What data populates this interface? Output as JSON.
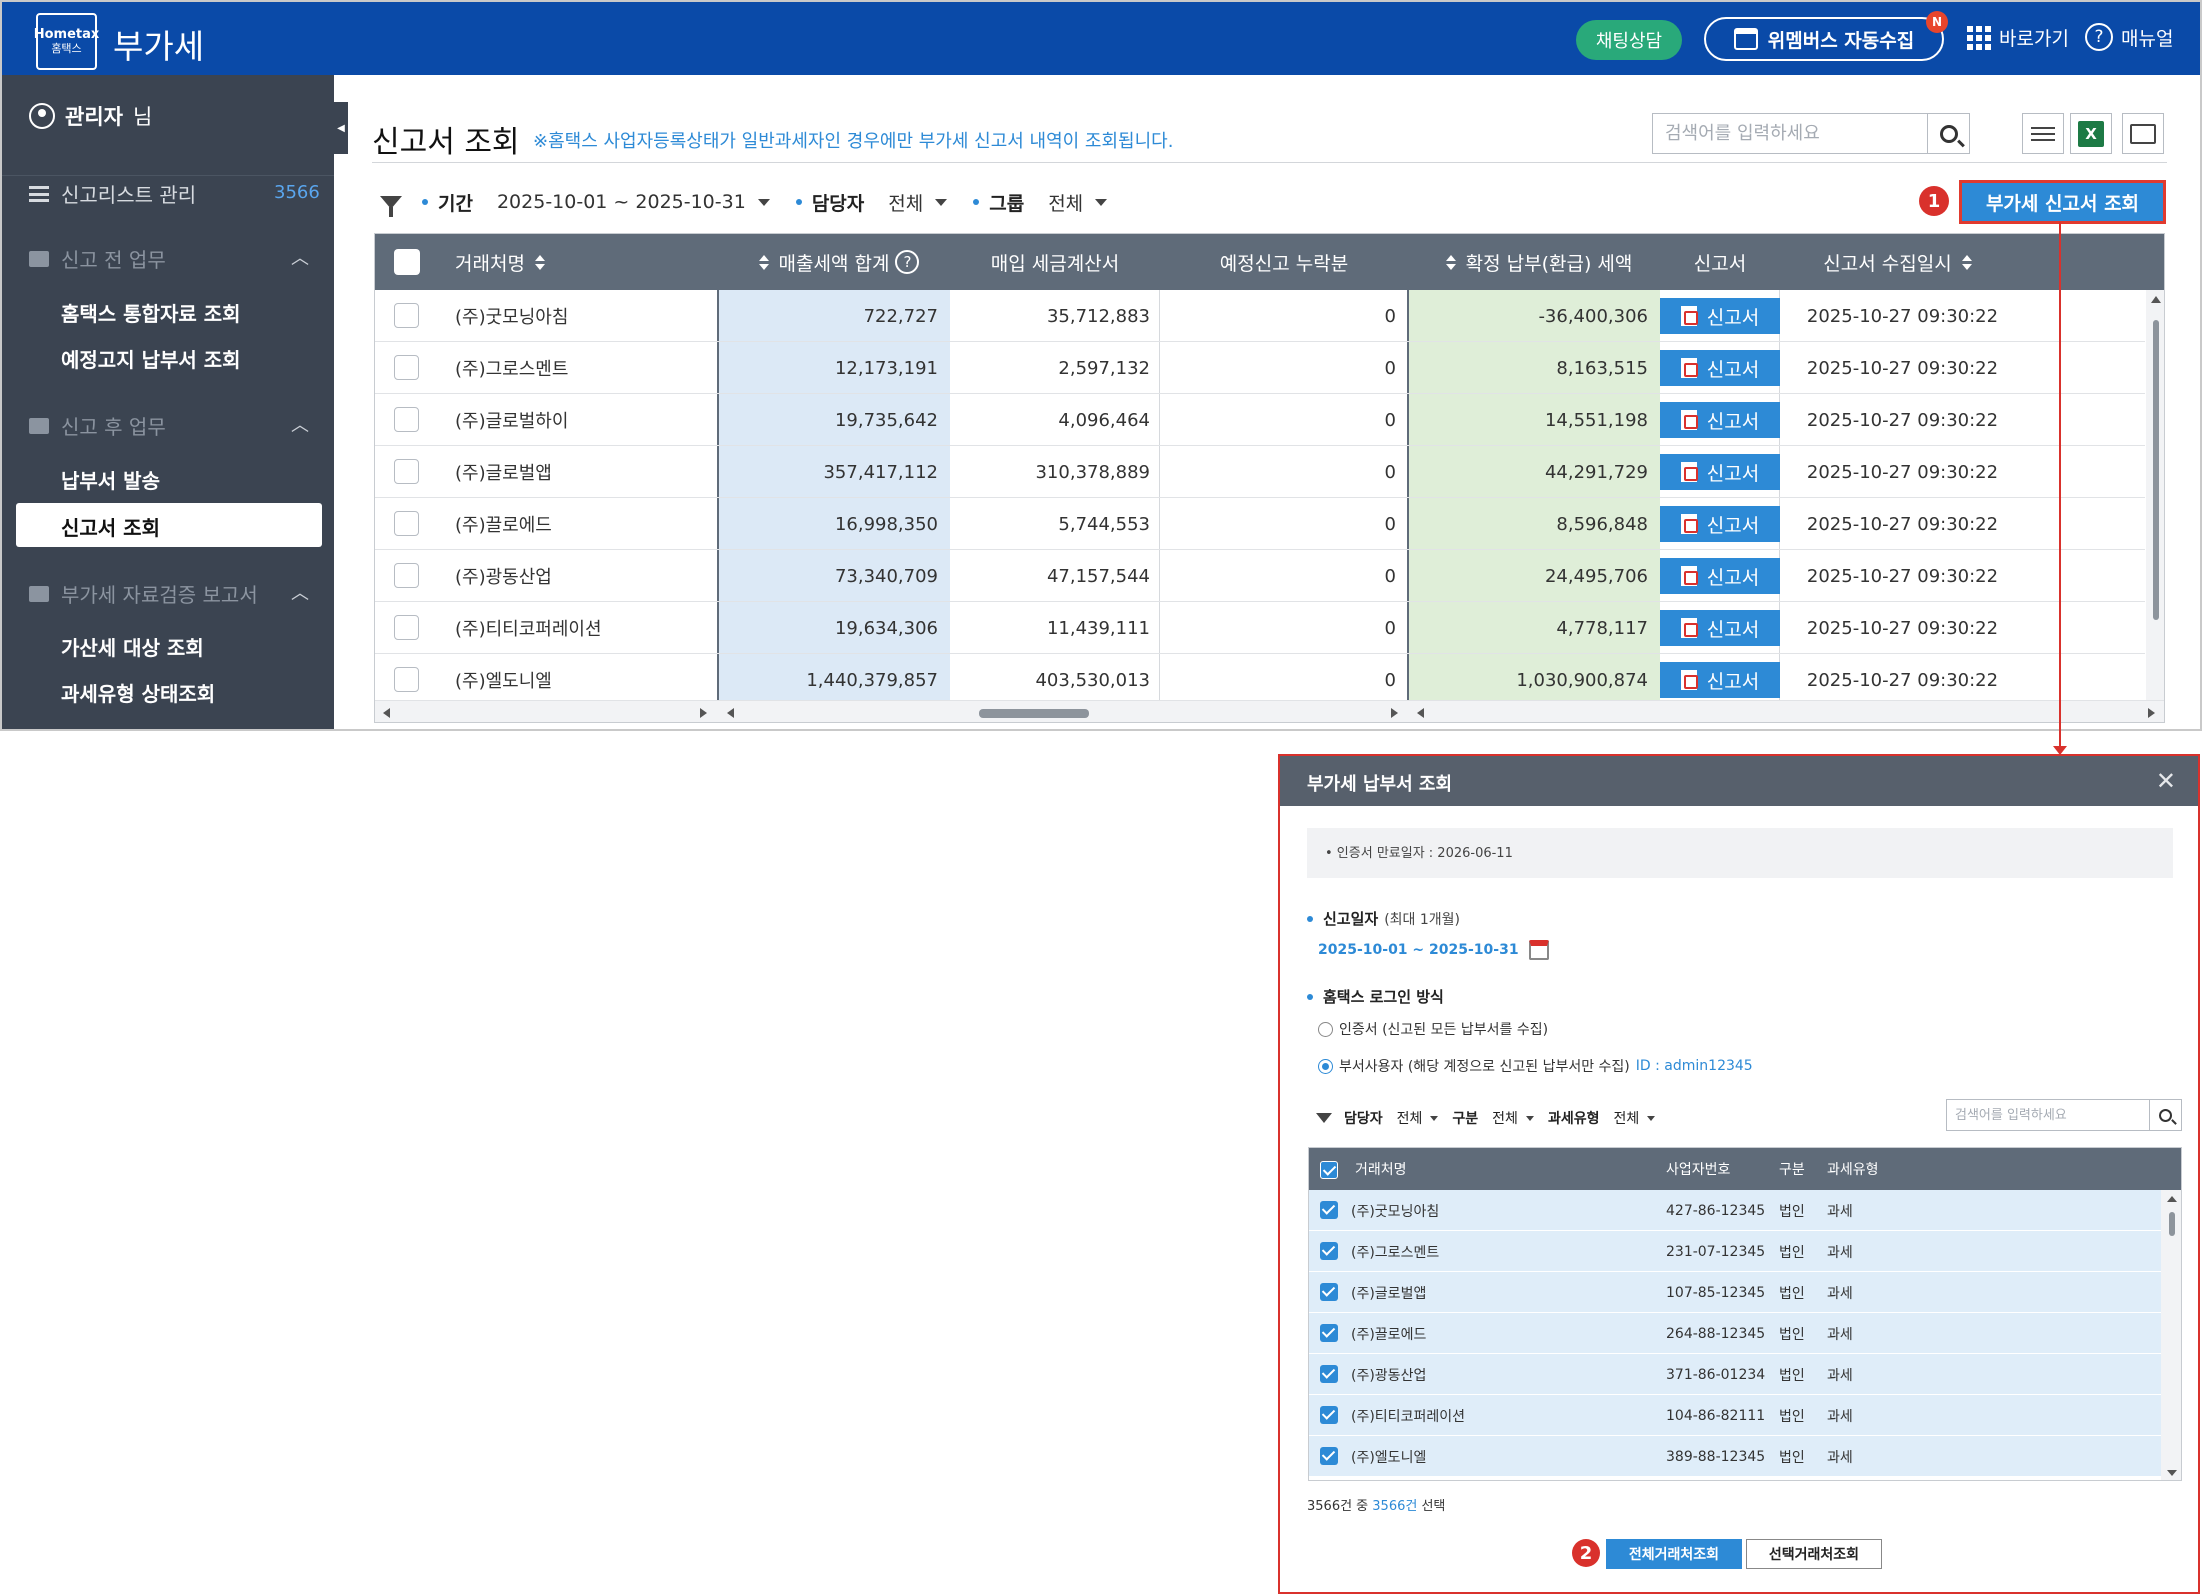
{
  "header": {
    "logo_text": "Hometax",
    "logo_sub": "홈택스",
    "title": "부가세",
    "chat_label": "채팅상담",
    "wemembus_label": "위멤버스 자동수집",
    "new_badge": "N",
    "shortcut_label": "바로가기",
    "manual_label": "매뉴얼",
    "manual_icon": "?"
  },
  "sidebar": {
    "admin_name": "관리자",
    "admin_suffix": "님",
    "report_list_label": "신고리스트 관리",
    "report_list_count": "3566",
    "groups": [
      {
        "label": "신고 전 업무",
        "items": [
          "홈택스 통합자료 조회",
          "예정고지 납부서 조회"
        ]
      },
      {
        "label": "신고 후 업무",
        "items": [
          "납부서 발송",
          "신고서 조회"
        ]
      },
      {
        "label": "부가세 자료검증 보고서",
        "items": [
          "가산세 대상 조회",
          "과세유형 상태조회"
        ]
      }
    ],
    "active_item": "신고서 조회",
    "collapse_icon": "◀"
  },
  "main": {
    "title": "신고서 조회",
    "note": "※홈택스 사업자등록상태가 일반과세자인 경우에만 부가세 신고서 내역이 조회됩니다.",
    "search_placeholder": "검색어를 입력하세요",
    "excel_label": "X",
    "filters": {
      "period_label": "기간",
      "period_value": "2025-10-01 ~ 2025-10-31",
      "manager_label": "담당자",
      "manager_value": "전체",
      "group_label": "그룹",
      "group_value": "전체"
    },
    "action_button": "부가세 신고서 조회",
    "callout_1": "1",
    "columns": [
      "거래처명",
      "매출세액 합계",
      "매입 세금계산서",
      "예정신고 누락분",
      "확정 납부(환급) 세액",
      "신고서",
      "신고서 수집일시"
    ],
    "help_icon": "?",
    "rows": [
      {
        "name": "(주)굿모닝아침",
        "sales_tax": "722,727",
        "purchase": "35,712,883",
        "omitted": "0",
        "payable": "-36,400,306",
        "report": "신고서",
        "collected": "2025-10-27 09:30:22"
      },
      {
        "name": "(주)그로스멘트",
        "sales_tax": "12,173,191",
        "purchase": "2,597,132",
        "omitted": "0",
        "payable": "8,163,515",
        "report": "신고서",
        "collected": "2025-10-27 09:30:22"
      },
      {
        "name": "(주)글로벌하이",
        "sales_tax": "19,735,642",
        "purchase": "4,096,464",
        "omitted": "0",
        "payable": "14,551,198",
        "report": "신고서",
        "collected": "2025-10-27 09:30:22"
      },
      {
        "name": "(주)글로벌앱",
        "sales_tax": "357,417,112",
        "purchase": "310,378,889",
        "omitted": "0",
        "payable": "44,291,729",
        "report": "신고서",
        "collected": "2025-10-27 09:30:22"
      },
      {
        "name": "(주)끌로에드",
        "sales_tax": "16,998,350",
        "purchase": "5,744,553",
        "omitted": "0",
        "payable": "8,596,848",
        "report": "신고서",
        "collected": "2025-10-27 09:30:22"
      },
      {
        "name": "(주)광동산업",
        "sales_tax": "73,340,709",
        "purchase": "47,157,544",
        "omitted": "0",
        "payable": "24,495,706",
        "report": "신고서",
        "collected": "2025-10-27 09:30:22"
      },
      {
        "name": "(주)티티코퍼레이션",
        "sales_tax": "19,634,306",
        "purchase": "11,439,111",
        "omitted": "0",
        "payable": "4,778,117",
        "report": "신고서",
        "collected": "2025-10-27 09:30:22"
      },
      {
        "name": "(주)엘도니엘",
        "sales_tax": "1,440,379,857",
        "purchase": "403,530,013",
        "omitted": "0",
        "payable": "1,030,900,874",
        "report": "신고서",
        "collected": "2025-10-27 09:30:22"
      }
    ]
  },
  "modal": {
    "title": "부가세 납부서 조회",
    "close_icon": "✕",
    "notice": "• 인증서 만료일자 : 2026-06-11",
    "date_label": "신고일자",
    "date_sub": "(최대 1개월)",
    "date_value": "2025-10-01 ~ 2025-10-31",
    "login_label": "홈택스 로그인 방식",
    "radio_cert": "인증서 (신고된 모든 납부서를 수집)",
    "radio_dept": "부서사용자 (해당 계정으로 신고된 납부서만 수집)",
    "radio_dept_id": "ID : admin12345",
    "filter_manager_label": "담당자",
    "filter_manager_value": "전체",
    "filter_type_label": "구분",
    "filter_type_value": "전체",
    "filter_tax_label": "과세유형",
    "filter_tax_value": "전체",
    "search_placeholder": "검색어를 입력하세요",
    "columns": [
      "거래처명",
      "사업자번호",
      "구분",
      "과세유형"
    ],
    "rows": [
      {
        "name": "(주)굿모닝아침",
        "biz_no": "427-86-12345",
        "kind": "법인",
        "tax_type": "과세"
      },
      {
        "name": "(주)그로스멘트",
        "biz_no": "231-07-12345",
        "kind": "법인",
        "tax_type": "과세"
      },
      {
        "name": "(주)글로벌앱",
        "biz_no": "107-85-12345",
        "kind": "법인",
        "tax_type": "과세"
      },
      {
        "name": "(주)끌로에드",
        "biz_no": "264-88-12345",
        "kind": "법인",
        "tax_type": "과세"
      },
      {
        "name": "(주)광동산업",
        "biz_no": "371-86-01234",
        "kind": "법인",
        "tax_type": "과세"
      },
      {
        "name": "(주)티티코퍼레이션",
        "biz_no": "104-86-82111",
        "kind": "법인",
        "tax_type": "과세"
      },
      {
        "name": "(주)엘도니엘",
        "biz_no": "389-88-12345",
        "kind": "법인",
        "tax_type": "과세"
      }
    ],
    "count_prefix": "3566건 중",
    "count_selected": "3566건",
    "count_suffix": "선택",
    "btn_all": "전체거래처조회",
    "btn_selected": "선택거래처조회",
    "callout_2": "2"
  }
}
